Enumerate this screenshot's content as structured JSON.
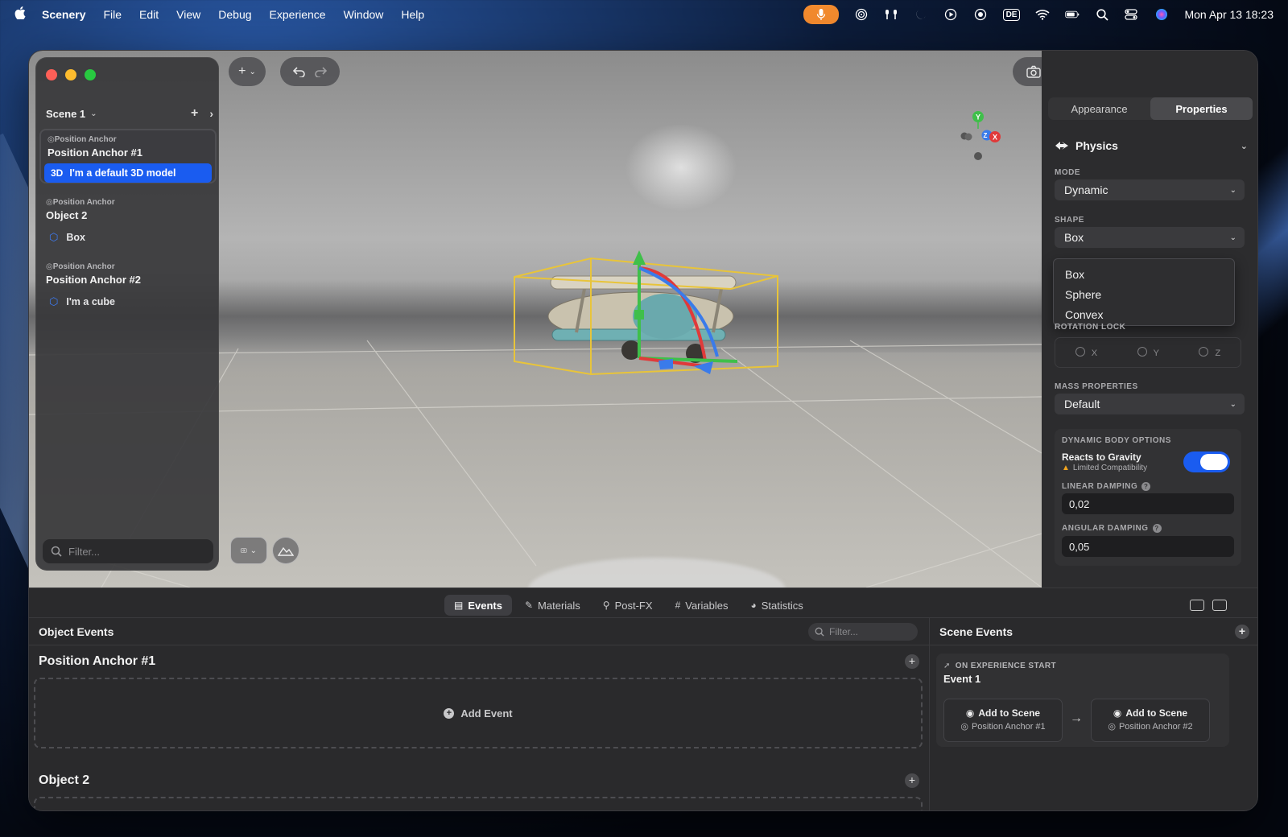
{
  "menubar": {
    "app_name": "Scenery",
    "items": [
      "File",
      "Edit",
      "View",
      "Debug",
      "Experience",
      "Window",
      "Help"
    ],
    "keyboard_layout": "DE",
    "clock": "Mon Apr 13  18:23"
  },
  "sidebar": {
    "scene_label": "Scene 1",
    "filter_placeholder": "Filter...",
    "groups": [
      {
        "caption": "Position Anchor",
        "title": "Position Anchor #1",
        "child_tag": "3D",
        "child_label": "I'm a default 3D model"
      },
      {
        "caption": "Position Anchor",
        "title": "Object 2",
        "child_label": "Box"
      },
      {
        "caption": "Position Anchor",
        "title": "Position Anchor #2",
        "child_label": "I'm a cube"
      }
    ]
  },
  "inspector": {
    "tabs": [
      "Appearance",
      "Properties"
    ],
    "active_tab": "Properties",
    "section_title": "Physics",
    "mode_label": "MODE",
    "mode_value": "Dynamic",
    "shape_label": "SHAPE",
    "shape_value": "Box",
    "shape_options": [
      "Box",
      "Sphere",
      "Convex"
    ],
    "rotation_lock_label": "ROTATION LOCK",
    "rotation_axes": [
      "X",
      "Y",
      "Z"
    ],
    "mass_label": "MASS PROPERTIES",
    "mass_value": "Default",
    "dynamic_options_label": "DYNAMIC BODY OPTIONS",
    "gravity_label": "Reacts to Gravity",
    "gravity_warning": "Limited Compatibility",
    "gravity_on": true,
    "linear_damping_label": "LINEAR DAMPING",
    "linear_damping_value": "0,02",
    "angular_damping_label": "ANGULAR DAMPING",
    "angular_damping_value": "0,05"
  },
  "gizmo": {
    "y": "Y",
    "x": "X",
    "z": "Z"
  },
  "bottom": {
    "tabs": [
      "Events",
      "Materials",
      "Post-FX",
      "Variables",
      "Statistics"
    ],
    "active_tab": "Events",
    "object_events_title": "Object Events",
    "filter_placeholder": "Filter...",
    "objects": [
      {
        "title": "Position Anchor #1",
        "add_event": "Add Event"
      },
      {
        "title": "Object 2"
      }
    ],
    "scene_events_title": "Scene Events",
    "event_caption": "ON EXPERIENCE START",
    "event_name": "Event 1",
    "actions": [
      {
        "title": "Add to Scene",
        "target": "Position Anchor #1"
      },
      {
        "title": "Add to Scene",
        "target": "Position Anchor #2"
      }
    ]
  },
  "colors": {
    "accent": "#1a5cf0",
    "mic": "#f28a2e",
    "bbox": "#e8c43a"
  }
}
